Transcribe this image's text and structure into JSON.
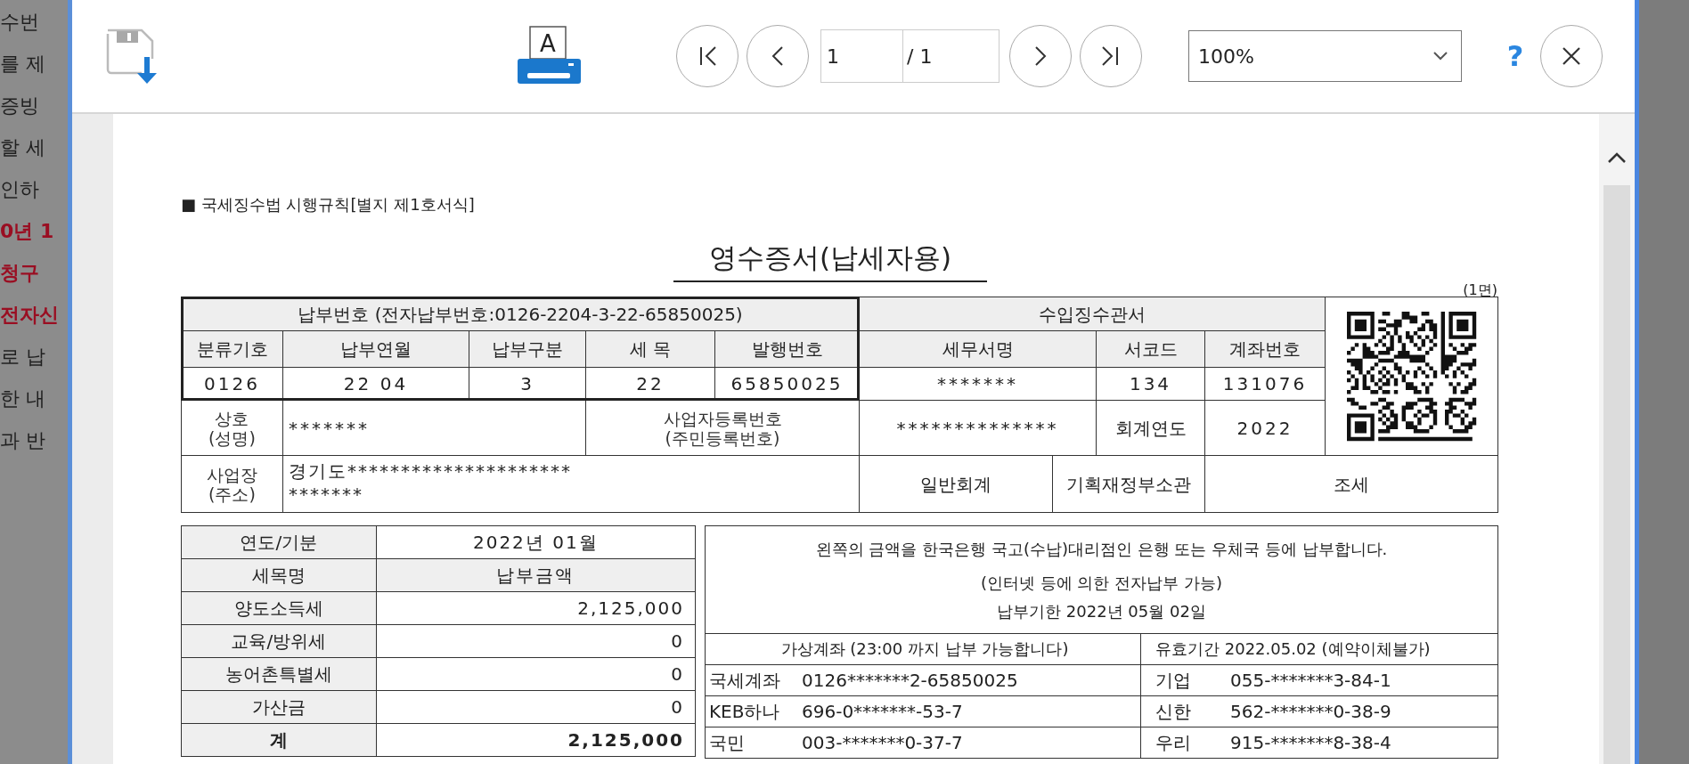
{
  "background_window": {
    "lines": [
      {
        "text": "수번",
        "kind": "normal"
      },
      {
        "text": "를 제",
        "kind": "normal"
      },
      {
        "text": "증빙",
        "kind": "normal"
      },
      {
        "text": "할 세",
        "kind": "normal"
      },
      {
        "text": "인하",
        "kind": "normal"
      },
      {
        "text": "0년 1",
        "kind": "emphasis"
      },
      {
        "text": "청구",
        "kind": "emphasis"
      },
      {
        "text": "전자신",
        "kind": "emphasis"
      },
      {
        "text": "로 납",
        "kind": "normal"
      },
      {
        "text": "한 내",
        "kind": "normal"
      },
      {
        "text": "과 반",
        "kind": "normal"
      }
    ]
  },
  "toolbar": {
    "print_letter": "A",
    "page_input": {
      "value": "1"
    },
    "page_total": "/ 1",
    "zoom_select": {
      "value": "100%"
    },
    "help_button": {
      "label": "?"
    }
  },
  "document": {
    "form_reference": "■ 국세징수법 시행규칙[별지 제1호서식]",
    "title": "영수증서(납세자용)",
    "page_label": "(1면)",
    "payment_number": "납부번호 (전자납부번호:0126-2204-3-22-65850025)",
    "collection_office": "수입징수관서",
    "header_cells": [
      "분류기호",
      "납부연월",
      "납부구분",
      "세 목",
      "발행번호",
      "세무서명",
      "서코드",
      "계좌번호"
    ],
    "value_cells": [
      "0126",
      "22 04",
      "3",
      "22",
      "65850025",
      "*******",
      "134",
      "131076"
    ],
    "business_name": {
      "label": "상호",
      "label_sub": "(성명)",
      "value": "*******"
    },
    "registration": {
      "label": "사업자등록번호",
      "label_sub": "(주민등록번호)",
      "value": "**************"
    },
    "fiscal_year": {
      "label": "회계연도",
      "value": "2022"
    },
    "business_address": {
      "label": "사업장",
      "label_sub": "(주소)",
      "value_lines": [
        "경기도*********************",
        "*******"
      ]
    },
    "account_type": "일반회계",
    "ministry": "기획재정부소관",
    "revenue_type": "조세",
    "tax_table": {
      "rows": [
        {
          "label": "연도/기분",
          "value": "2022년 01월",
          "kind": "period"
        },
        {
          "label": "세목명",
          "value": "납부금액",
          "kind": "column_header"
        },
        {
          "label": "양도소득세",
          "value": "2,125,000",
          "kind": "amount"
        },
        {
          "label": "교육/방위세",
          "value": "0",
          "kind": "amount"
        },
        {
          "label": "농어촌특별세",
          "value": "0",
          "kind": "amount"
        },
        {
          "label": "가산금",
          "value": "0",
          "kind": "amount"
        },
        {
          "label": "계",
          "value": "2,125,000",
          "kind": "total"
        }
      ]
    },
    "payment_info": {
      "notice": "왼쪽의 금액을 한국은행 국고(수납)대리점인 은행 또는 우체국 등에 납부합니다.",
      "electronic": "(인터넷 등에 의한 전자납부 가능)",
      "deadline": "납부기한  2022년 05월 02일",
      "virtual_account_header": "가상계좌 (23:00 까지 납부 가능합니다)",
      "validity": "유효기간  2022.05.02  (예약이체불가)",
      "accounts": [
        {
          "left": {
            "bank": "국세계좌",
            "number": "0126*******2-65850025"
          },
          "right": {
            "bank": "기업",
            "number": "055-*******3-84-1"
          }
        },
        {
          "left": {
            "bank": "KEB하나",
            "number": "696-0*******-53-7"
          },
          "right": {
            "bank": "신한",
            "number": "562-*******0-38-9"
          }
        },
        {
          "left": {
            "bank": "국민",
            "number": "003-*******0-37-7"
          },
          "right": {
            "bank": "우리",
            "number": "915-*******8-38-4"
          }
        }
      ]
    }
  }
}
